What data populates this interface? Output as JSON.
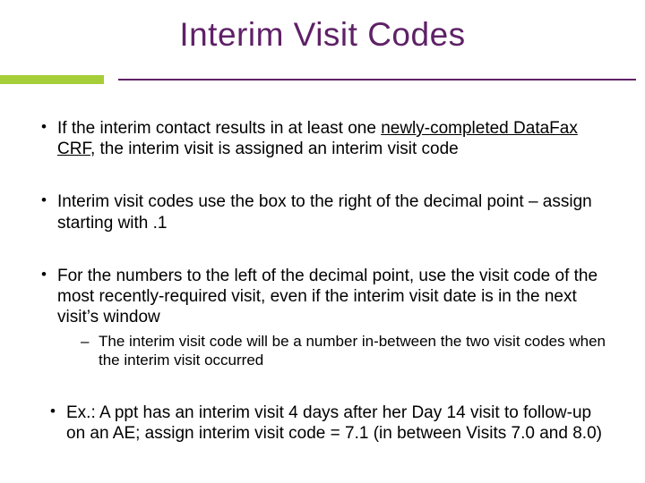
{
  "title": "Interim Visit Codes",
  "bullets": [
    {
      "pre": "If the interim contact results in at least one ",
      "underlined": "newly-completed DataFax CRF",
      "post": ", the interim visit is assigned an interim visit code"
    },
    {
      "text": "Interim visit codes use the box to the right of the decimal point – assign starting with .1"
    },
    {
      "text": "For the numbers to the left of the decimal point, use the visit code of the most recently-required visit, even if the interim visit date is in the next visit’s window",
      "sub": "The interim visit code will be a number in-between the two visit codes when the interim visit occurred"
    }
  ],
  "last": "Ex.: A ppt has an interim visit 4 days after her Day 14 visit to follow-up on an AE; assign interim visit code = 7.1 (in between Visits 7.0 and 8.0)"
}
